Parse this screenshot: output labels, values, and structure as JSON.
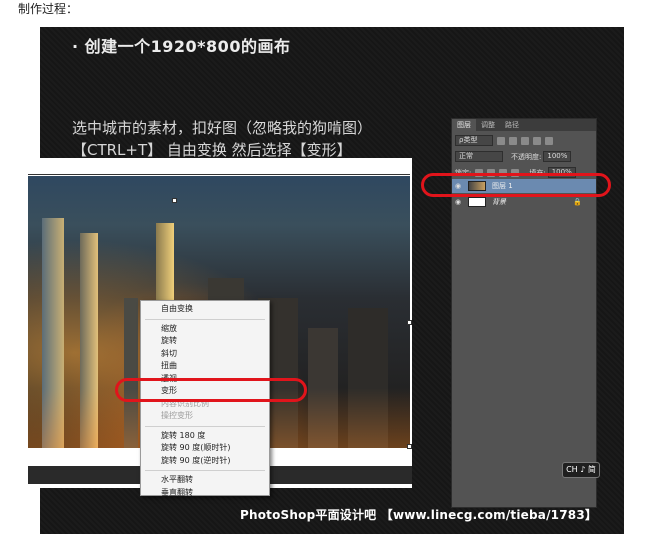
{
  "caption": "制作过程：",
  "heading": "· 创建一个1920*800的画布",
  "instruction_line1": "选中城市的素材，扣好图（忽略我的狗啃图）",
  "instruction_line2": "【CTRL+T】 自由变换 然后选择【变形】",
  "context_menu": {
    "group1": [
      "自由变换"
    ],
    "group2": [
      "缩放",
      "旋转",
      "斜切",
      "扭曲",
      "透视",
      "变形"
    ],
    "group2_disabled": [
      "内容识别比例",
      "操控变形"
    ],
    "group3": [
      "旋转 180 度",
      "旋转 90 度(顺时针)",
      "旋转 90 度(逆时针)"
    ],
    "group4": [
      "水平翻转",
      "垂直翻转"
    ]
  },
  "layers_panel": {
    "tabs": [
      "图层",
      "调整",
      "路径"
    ],
    "filter_label": "ρ类型",
    "blend_mode": "正常",
    "opacity_label": "不透明度:",
    "opacity_value": "100%",
    "lock_label": "锁定:",
    "fill_label": "填充:",
    "fill_value": "100%",
    "layers": [
      {
        "name": "图层 1",
        "selected": true
      },
      {
        "name": "背景",
        "selected": false
      }
    ]
  },
  "ime_badge": "CH ♪ 简",
  "watermark": "PhotoShop平面设计吧 【www.linecg.com/tieba/1783】",
  "colors": {
    "highlight": "#e1141b",
    "selected_layer": "#6b8ab0",
    "panel_bg": "#535353"
  }
}
